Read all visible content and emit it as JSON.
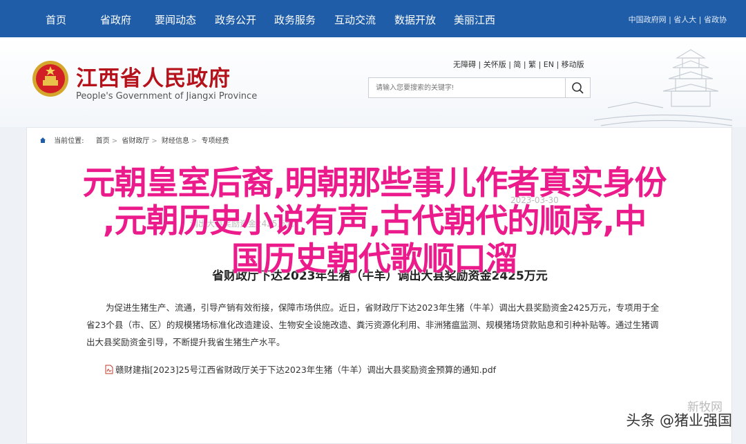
{
  "nav": {
    "items": [
      "首页",
      "省政府",
      "要闻动态",
      "政务公开",
      "政务服务",
      "互动交流",
      "数据开放",
      "美丽江西"
    ],
    "top_links": "中国政府网 | 省人大 | 省政协"
  },
  "header": {
    "title": "江西省人民政府",
    "subtitle": "People's Government of Jiangxi Province",
    "util_links": "无障碍 | 关怀版 | 简 | 繁 | EN | 移动版",
    "search_placeholder": "请输入您要搜索的关键字!"
  },
  "breadcrumb": {
    "label": "当前位置:",
    "items": [
      "首页",
      "省财政厅",
      "财经信息",
      "专项经费"
    ]
  },
  "article": {
    "meta_partial_1": "2023-03-30",
    "meta_partial_2": "调出大县奖励资金2425万元",
    "title": "省财政厅下达2023年生猪（牛羊）调出大县奖励资金2425万元",
    "body": "为促进生猪生产、流通，引导产销有效衔接，保障市场供应。近日，省财政厅下达2023年生猪（牛羊）调出大县奖励资金2425万元，专项用于全省23个县（市、区）的规模猪场标准化改造建设、生物安全设施改造、粪污资源化利用、非洲猪瘟监测、规模猪场贷款贴息和引种补贴等。通过生猪调出大县奖励资金引导，不断提升我省生猪生产水平。",
    "attachment": "赣财建指[2023]25号江西省财政厅关于下达2023年生猪（牛羊）调出大县奖励资金预算的通知.pdf"
  },
  "overlay": {
    "line1": "元朝皇室后裔,明朝那些事儿作者真实身份",
    "line2": ",元朝历史小说有声,古代朝代的顺序,中",
    "line3": "国历史朝代歌顺口溜"
  },
  "watermarks": {
    "toutiao": "头条 @猪业强国",
    "xinhua": "新牧网"
  },
  "colors": {
    "nav_bg": "#1f5da8",
    "title_red": "#b5121b",
    "overlay_pink": "#ec1b8c"
  }
}
